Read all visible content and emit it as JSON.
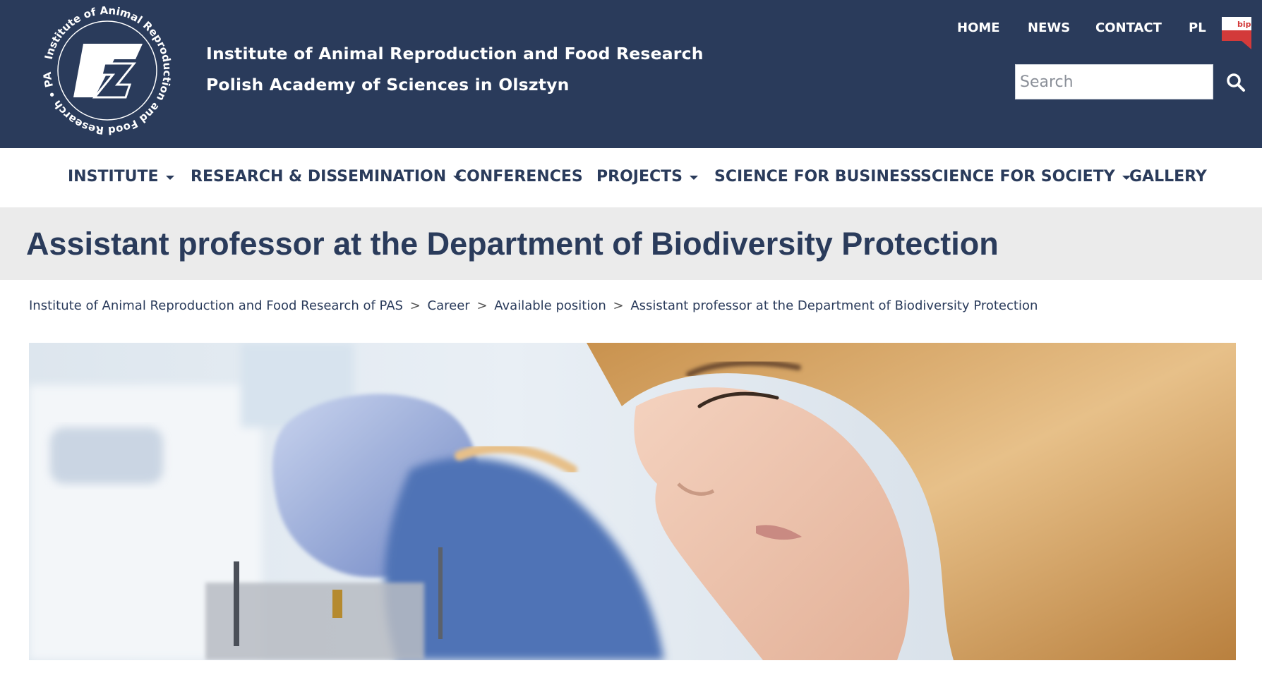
{
  "header": {
    "logo_ring_text": "Institute of Animal Reproduction and Food Research • PAS •",
    "logo_mark": "IZ",
    "title_line1": "Institute of Animal Reproduction and Food Research",
    "title_line2": "Polish Academy of Sciences in Olsztyn",
    "bip_label": "bip",
    "bip_icon": "bip-flag-icon",
    "top_nav": [
      {
        "label": "HOME"
      },
      {
        "label": "NEWS"
      },
      {
        "label": "CONTACT"
      },
      {
        "label": "PL"
      }
    ],
    "search": {
      "placeholder": "Search",
      "value": "",
      "icon": "search-icon"
    }
  },
  "main_nav": [
    {
      "label": "INSTITUTE",
      "has_dropdown": true
    },
    {
      "label": "RESEARCH & DISSEMINATION",
      "has_dropdown": true
    },
    {
      "label": "CONFERENCES",
      "has_dropdown": false
    },
    {
      "label": "PROJECTS",
      "has_dropdown": true
    },
    {
      "label": "SCIENCE FOR BUSINESS",
      "has_dropdown": false
    },
    {
      "label": "SCIENCE FOR SOCIETY",
      "has_dropdown": true
    },
    {
      "label": "GALLERY",
      "has_dropdown": false
    }
  ],
  "page": {
    "title": "Assistant professor at the Department of Biodiversity Protection"
  },
  "breadcrumb": {
    "items": [
      {
        "label": "Institute of Animal Reproduction and Food Research of PAS"
      },
      {
        "label": "Career"
      },
      {
        "label": "Available position"
      },
      {
        "label": "Assistant professor at the Department of Biodiversity Protection"
      }
    ],
    "separator": ">"
  },
  "colors": {
    "header_bg": "#2a3b5b",
    "nav_text": "#2a3b5b",
    "title_band_bg": "#ebebeb",
    "bip_red": "#d33a3a"
  }
}
